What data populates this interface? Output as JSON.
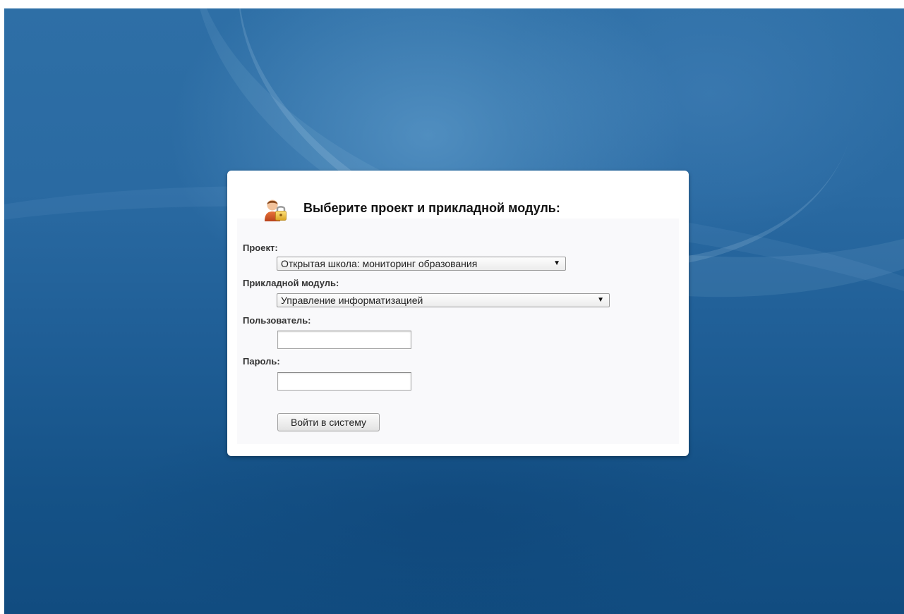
{
  "dialog": {
    "title": "Выберите проект и прикладной модуль:",
    "icon": "user-lock-icon"
  },
  "project": {
    "label": "Проект:",
    "selected": "Открытая школа: мониторинг образования"
  },
  "module": {
    "label": "Прикладной модуль:",
    "selected": "Управление информатизацией"
  },
  "user": {
    "label": "Пользователь:",
    "value": ""
  },
  "password": {
    "label": "Пароль:",
    "value": ""
  },
  "login_button": {
    "label": "Войти в систему"
  },
  "colors": {
    "desktop_blue": "#1f5e96",
    "dialog_bg": "#ffffff",
    "panel_bg": "#f9f9fb"
  }
}
